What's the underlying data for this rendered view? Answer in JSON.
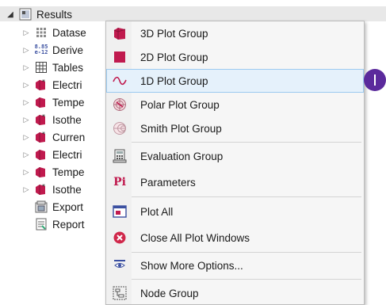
{
  "tree": {
    "root_label": "Results",
    "children": [
      {
        "label": "Datase",
        "icon": "dataset-icon"
      },
      {
        "label": "Derive",
        "icon": "derived-values-icon"
      },
      {
        "label": "Tables",
        "icon": "table-icon"
      },
      {
        "label": "Electri",
        "icon": "plot-group-star-icon"
      },
      {
        "label": "Tempe",
        "icon": "plot-group-icon"
      },
      {
        "label": "Isothe",
        "icon": "plot-group-star-icon"
      },
      {
        "label": "Curren",
        "icon": "plot-group-star-icon"
      },
      {
        "label": "Electri",
        "icon": "plot-group-icon"
      },
      {
        "label": "Tempe",
        "icon": "plot-group-icon"
      },
      {
        "label": "Isothe",
        "icon": "plot-group-star-icon"
      },
      {
        "label": "Export",
        "icon": "export-icon"
      },
      {
        "label": "Report",
        "icon": "report-icon"
      }
    ]
  },
  "menu": {
    "items": [
      {
        "label": "3D Plot Group",
        "icon": "3d-plot-group-icon"
      },
      {
        "label": "2D Plot Group",
        "icon": "2d-plot-group-icon"
      },
      {
        "label": "1D Plot Group",
        "icon": "1d-plot-group-icon",
        "highlighted": true
      },
      {
        "label": "Polar Plot Group",
        "icon": "polar-plot-group-icon"
      },
      {
        "label": "Smith Plot Group",
        "icon": "smith-plot-group-icon"
      },
      {
        "label": "Evaluation Group",
        "icon": "evaluation-group-icon"
      },
      {
        "label": "Parameters",
        "icon": "parameters-icon"
      },
      {
        "label": "Plot All",
        "icon": "plot-all-icon"
      },
      {
        "label": "Close All Plot Windows",
        "icon": "close-all-icon"
      },
      {
        "label": "Show More Options...",
        "icon": "more-options-icon"
      },
      {
        "label": "Node Group",
        "icon": "node-group-icon"
      }
    ]
  },
  "icon_glyphs": {
    "derived": "8.85\ne-12",
    "parameters": "Pi"
  },
  "colors": {
    "plot_group": "#c01a4e",
    "highlight": "#e5f1fb",
    "cursor": "#5b2a9c",
    "close": "#d0284b"
  }
}
